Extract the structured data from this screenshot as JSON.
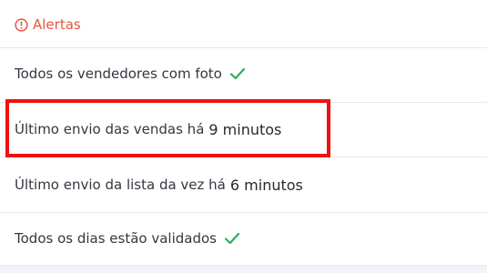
{
  "header": {
    "title": "Alertas",
    "icon": "alert-circle-icon",
    "color": "#e8553e"
  },
  "alerts": [
    {
      "text": "Todos os vendedores com foto",
      "status_icon": "check-icon"
    },
    {
      "text": "Último envio das vendas há",
      "emphasis": "9 minutos",
      "highlighted": true
    },
    {
      "text": "Último envio da lista da vez há",
      "emphasis": "6 minutos"
    },
    {
      "text": "Todos os dias estão validados",
      "status_icon": "check-icon"
    }
  ],
  "colors": {
    "check": "#27ae60",
    "highlight_border": "#ee1111",
    "divider": "#e6e8ec"
  }
}
